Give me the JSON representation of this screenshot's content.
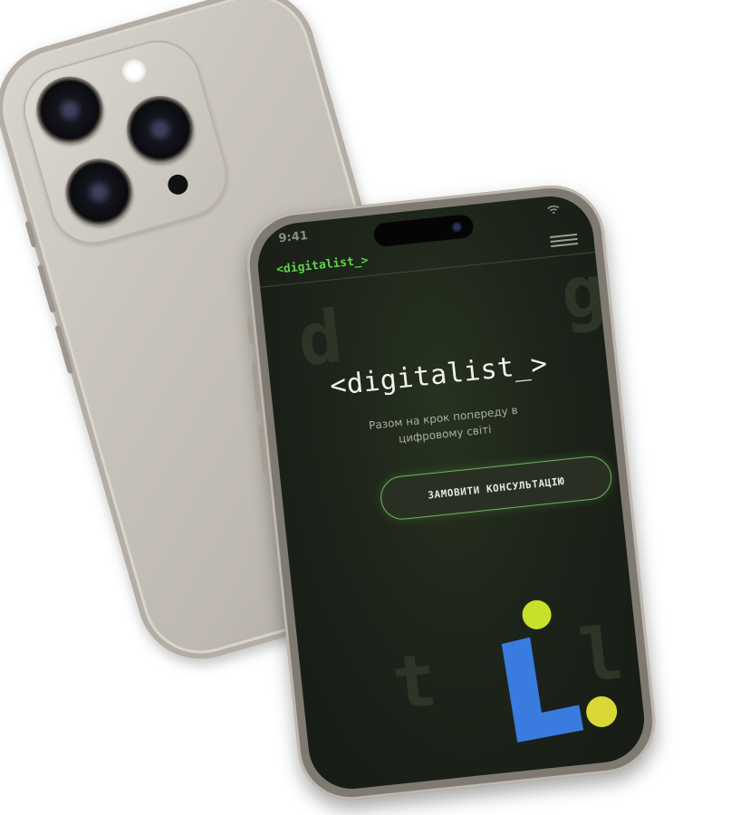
{
  "status_bar": {
    "time": "9:41"
  },
  "header": {
    "logo": "<digitalist_>",
    "menu_icon": "hamburger-menu-icon"
  },
  "hero": {
    "title": "<digitalist_>",
    "subtitle_line1": "Разом на крок попереду в",
    "subtitle_line2": "цифровому світі",
    "cta_label": "ЗАМОВИТИ КОНСУЛЬТАЦІЮ"
  },
  "background_letters": [
    "d",
    "g",
    "t",
    "l"
  ],
  "colors": {
    "accent_green": "#5fd34a",
    "screen_bg": "#1d241a",
    "deco_blue": "#3a7be0",
    "deco_lime": "#c8e02a",
    "deco_yellow": "#d9d838"
  }
}
